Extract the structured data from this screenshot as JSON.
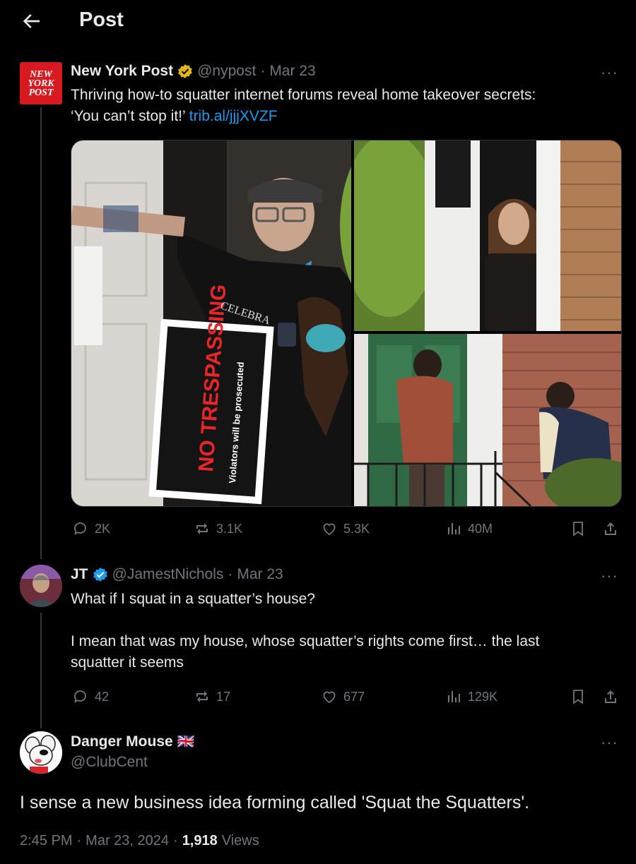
{
  "header": {
    "title": "Post"
  },
  "posts": [
    {
      "author_name": "New York Post",
      "handle": "@nypost",
      "date": "Mar 23",
      "text_line1": "Thriving how-to squatter internet forums reveal home takeover secrets:",
      "text_line2": "‘You can’t stop it!’",
      "link": "trib.al/jjjXVZF",
      "logo_text": [
        "NEW",
        "YORK",
        "POST"
      ],
      "image_sign": {
        "main": "NO TRESPASSING",
        "sub": "Violators will be prosecuted"
      },
      "shirt_text": "CELEBRA",
      "stats": {
        "replies": "2K",
        "reposts": "3.1K",
        "likes": "5.3K",
        "views": "40M"
      }
    },
    {
      "author_name": "JT",
      "handle": "@JamestNichols",
      "date": "Mar 23",
      "text_line1": "What if I squat in a squatter’s house?",
      "text_line2": "I mean that was my house, whose squatter’s rights come first… the last",
      "text_line3": "squatter it seems",
      "stats": {
        "replies": "42",
        "reposts": "17",
        "likes": "677",
        "views": "129K"
      }
    }
  ],
  "main_post": {
    "author_name": "Danger Mouse",
    "flag": "🇬🇧",
    "handle": "@ClubCent",
    "text": "I sense a new business idea forming called 'Squat the Squatters'.",
    "time": "2:45 PM",
    "date": "Mar 23, 2024",
    "views_count": "1,918",
    "views_label": "Views"
  },
  "more_label": "···",
  "separator": "·",
  "colors": {
    "background": "#000000",
    "text": "#e7e9ea",
    "muted": "#71767b",
    "link": "#1d9bf0",
    "verified_gold": "#e2b719",
    "verified_blue": "#1d9bf0",
    "nypost_red": "#d71920"
  }
}
